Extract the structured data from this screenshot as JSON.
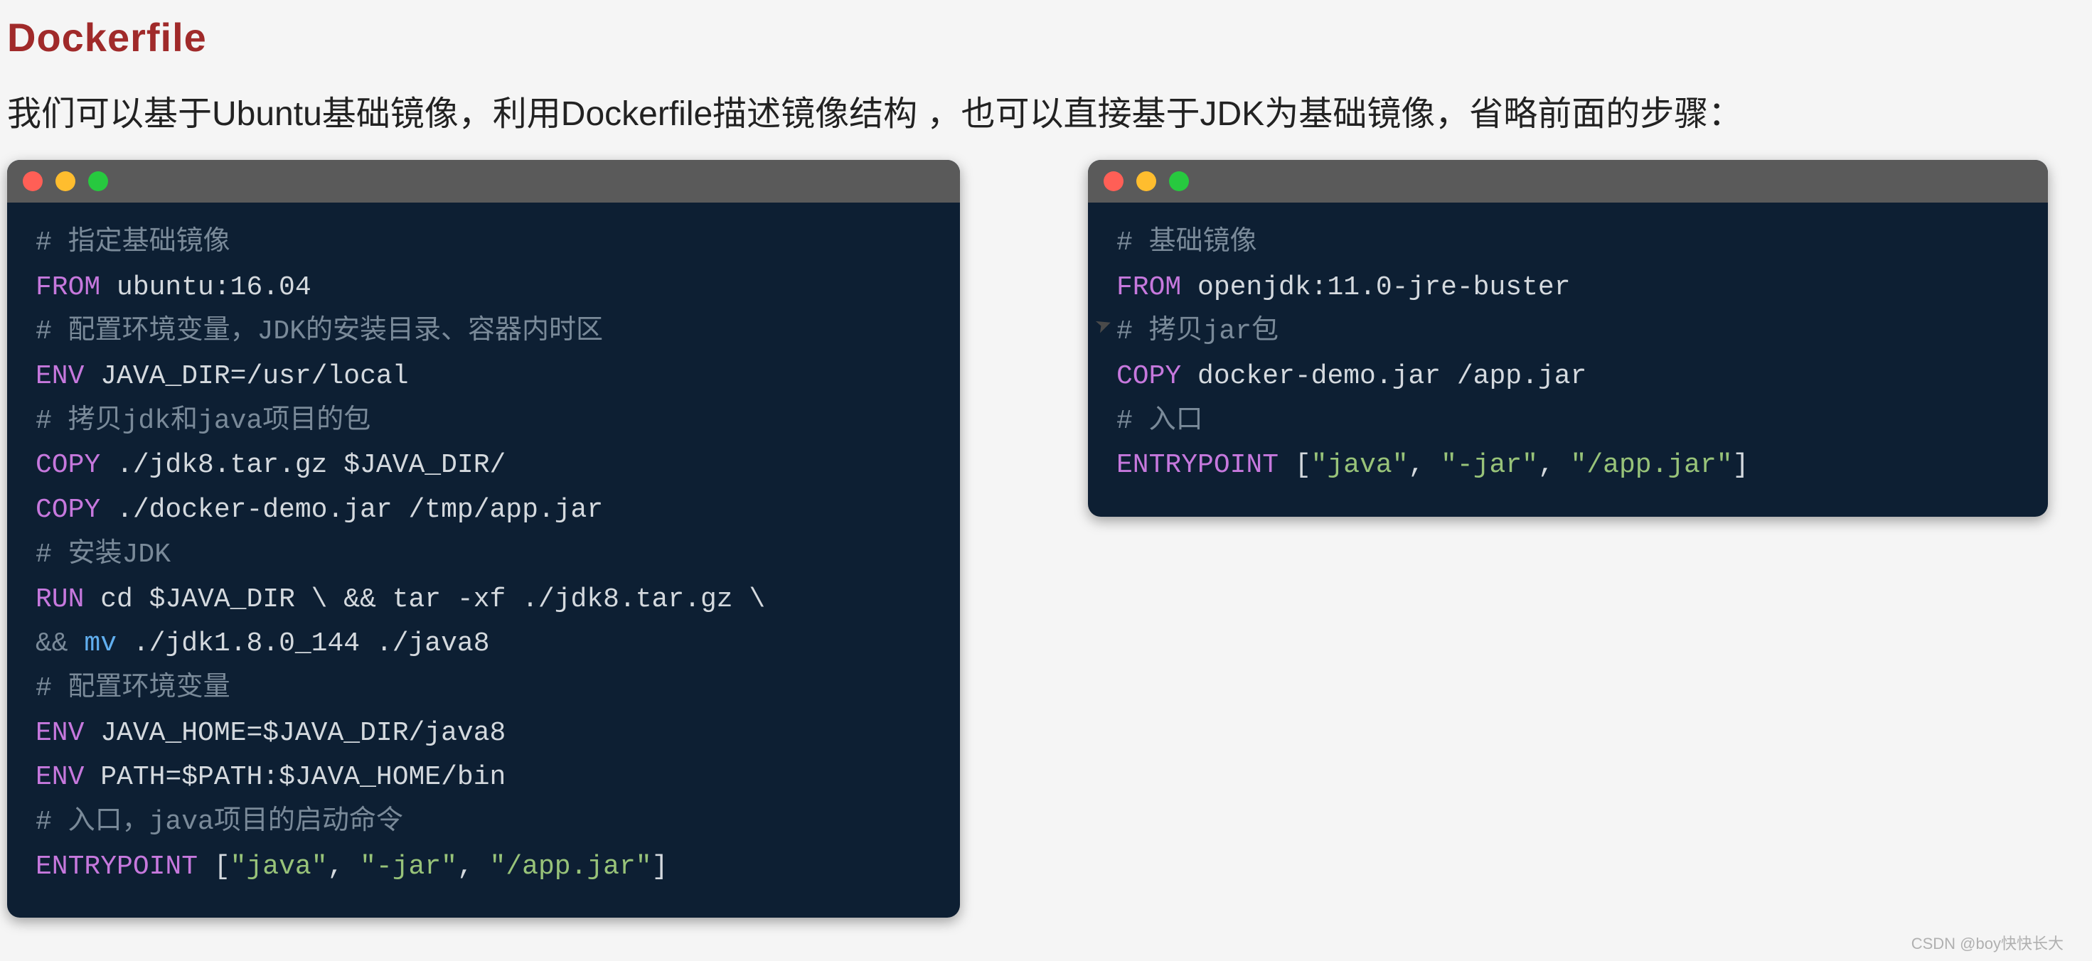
{
  "heading": "Dockerfile",
  "intro": "我们可以基于Ubuntu基础镜像，利用Dockerfile描述镜像结构 ，也可以直接基于JDK为基础镜像，省略前面的步骤：",
  "left": {
    "c1": "# 指定基础镜像",
    "l1_kw": "FROM",
    "l1_rest": " ubuntu:16.04",
    "c2": "# 配置环境变量，JDK的安装目录、容器内时区",
    "l2_kw": "ENV",
    "l2_rest": " JAVA_DIR=/usr/local",
    "c3": "# 拷贝jdk和java项目的包",
    "l3_kw": "COPY",
    "l3_rest": " ./jdk8.tar.gz $JAVA_DIR/",
    "l4_kw": "COPY",
    "l4_rest": " ./docker-demo.jar /tmp/app.jar",
    "c4": "# 安装JDK",
    "l5_kw": "RUN",
    "l5_rest": " cd $JAVA_DIR \\ && tar -xf ./jdk8.tar.gz \\",
    "l6_op": "&& ",
    "l6_mv": "mv",
    "l6_rest": " ./jdk1.8.0_144 ./java8",
    "c5": "# 配置环境变量",
    "l7_kw": "ENV",
    "l7_rest": " JAVA_HOME=$JAVA_DIR/java8",
    "l8_kw": "ENV",
    "l8_rest": " PATH=$PATH:$JAVA_HOME/bin",
    "c6": "# 入口，java项目的启动命令",
    "l9_kw": "ENTRYPOINT",
    "l9_sp": " ",
    "l9_b1": "[",
    "l9_s1": "\"java\"",
    "l9_d1": ", ",
    "l9_s2": "\"-jar\"",
    "l9_d2": ", ",
    "l9_s3": "\"/app.jar\"",
    "l9_b2": "]"
  },
  "right": {
    "c1": "# 基础镜像",
    "l1_kw": "FROM",
    "l1_rest": " openjdk:11.0-jre-buster",
    "c2": "# 拷贝jar包",
    "l2_kw": "COPY",
    "l2_rest": " docker-demo.jar /app.jar",
    "c3": "# 入口",
    "l3_kw": "ENTRYPOINT",
    "l3_sp": " ",
    "l3_b1": "[",
    "l3_s1": "\"java\"",
    "l3_d1": ", ",
    "l3_s2": "\"-jar\"",
    "l3_d2": ", ",
    "l3_s3": "\"/app.jar\"",
    "l3_b2": "]"
  },
  "watermark": "CSDN @boy快快长大"
}
